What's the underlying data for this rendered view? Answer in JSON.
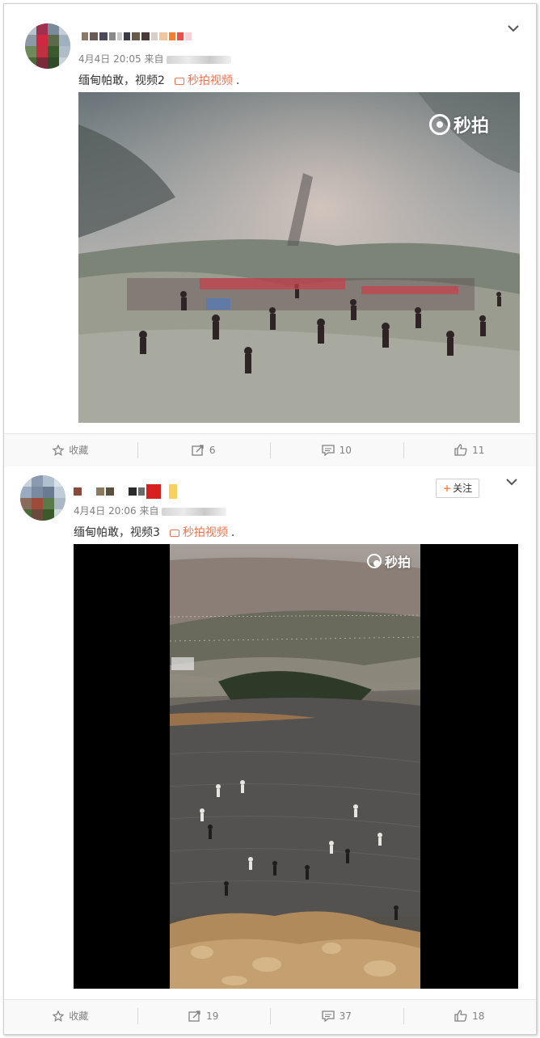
{
  "posts": [
    {
      "time": "4月4日 20:05",
      "source_prefix": "来自",
      "text": "缅甸帕敢，视频2",
      "video_link": "秒拍视频",
      "trail": ".",
      "watermark": "秒拍",
      "actions": {
        "favorite": "收藏",
        "repost": "6",
        "comment": "10",
        "like": "11"
      }
    },
    {
      "time": "4月4日 20:06",
      "source_prefix": "来自",
      "text": "缅甸帕敢，视频3",
      "video_link": "秒拍视频",
      "trail": ".",
      "watermark": "秒拍",
      "follow_label": "关注",
      "actions": {
        "favorite": "收藏",
        "repost": "19",
        "comment": "37",
        "like": "18"
      }
    }
  ],
  "icons": {
    "expand": "chevron-down-icon",
    "favorite": "star-icon",
    "repost": "repost-icon",
    "comment": "comment-icon",
    "like": "thumbs-up-icon",
    "video": "video-icon"
  },
  "colors": {
    "link": "#eb7350",
    "follow_plus": "#ff8140",
    "meta": "#808080"
  }
}
